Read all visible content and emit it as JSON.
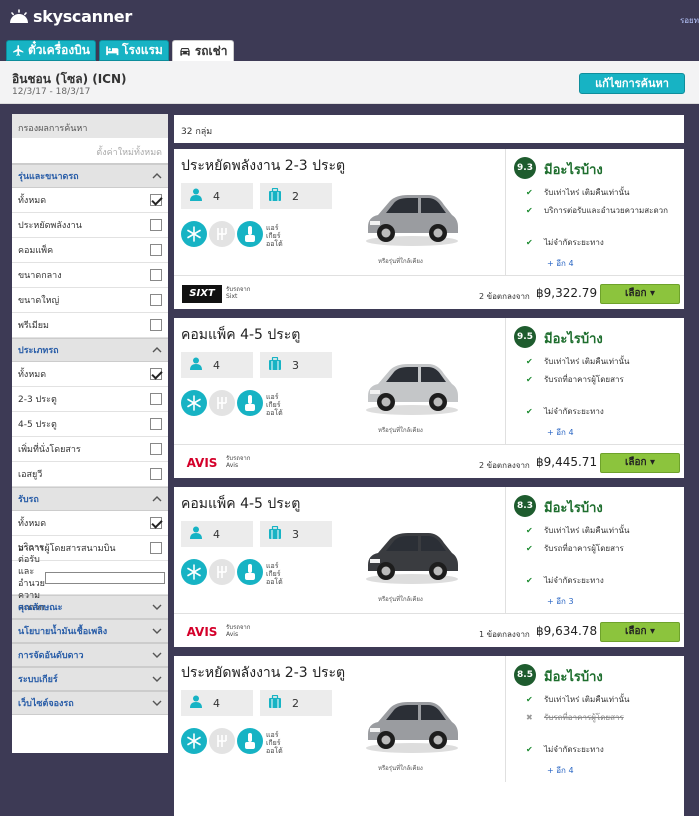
{
  "header": {
    "brand": "skyscanner",
    "top_right": "รอยท"
  },
  "tabs": [
    {
      "label": "ตั๋วเครื่องบิน",
      "icon": "plane-icon",
      "active": false
    },
    {
      "label": "โรงแรม",
      "icon": "bed-icon",
      "active": false
    },
    {
      "label": "รถเช่า",
      "icon": "car-icon",
      "active": true
    }
  ],
  "search": {
    "location": "อินชอน (โซล) (ICN)",
    "dates": "12/3/17 - 18/3/17",
    "edit_label": "แก้ไขการค้นหา"
  },
  "sidebar": {
    "header": "กรองผลการค้นหา",
    "search_placeholder": "ตั้งค่าใหม่ทั้งหมด",
    "sections": [
      {
        "title": "รุ่นและขนาดรถ",
        "expanded": true,
        "options": [
          {
            "label": "ทั้งหมด",
            "checked": true
          },
          {
            "label": "ประหยัดพลังงาน",
            "checked": false
          },
          {
            "label": "คอมแพ็ค",
            "checked": false
          },
          {
            "label": "ขนาดกลาง",
            "checked": false
          },
          {
            "label": "ขนาดใหญ่",
            "checked": false
          },
          {
            "label": "พรีเมียม",
            "checked": false
          }
        ]
      },
      {
        "title": "ประเภทรถ",
        "expanded": true,
        "options": [
          {
            "label": "ทั้งหมด",
            "checked": true
          },
          {
            "label": "2-3 ประตู",
            "checked": false
          },
          {
            "label": "4-5 ประตู",
            "checked": false
          },
          {
            "label": "เพิ่มที่นั่งโดยสาร",
            "checked": false
          },
          {
            "label": "เอสยูวี",
            "checked": false
          }
        ]
      },
      {
        "title": "รับรถ",
        "expanded": true,
        "options": [
          {
            "label": "ทั้งหมด",
            "checked": true
          },
          {
            "label": "อาคารผู้โดยสารสนามบิน",
            "checked": false
          },
          {
            "label": "บริการต่อรับและอำนวยความสะดวก",
            "checked": false
          }
        ]
      },
      {
        "title": "คุณลักษณะ",
        "expanded": false
      },
      {
        "title": "นโยบายน้ำมันเชื้อเพลิง",
        "expanded": false
      },
      {
        "title": "การจัดอันดับดาว",
        "expanded": false
      },
      {
        "title": "ระบบเกียร์",
        "expanded": false
      },
      {
        "title": "เว็บไซต์จองรถ",
        "expanded": false
      }
    ]
  },
  "results": {
    "count_label": "32 กลุ่ม",
    "cards": [
      {
        "title": "ประหยัดพลังงาน 2-3 ประตู",
        "seats": "4",
        "bags": "2",
        "feature_label": [
          "แอร์",
          "เกียร์",
          "ออโต้"
        ],
        "car_color": "#9a9ca0",
        "car_note": "หรือรุ่นที่ใกล้เคียง",
        "score": "9.3",
        "incl_title": "มีอะไรบ้าง",
        "included": [
          {
            "text": "รับเท่าไหร่ เติมคืนเท่านั้น",
            "ok": true
          },
          {
            "text": "บริการต่อรับและอำนวยความสะดวก",
            "ok": true
          },
          {
            "text": "ไม่จำกัดระยะทาง",
            "ok": true
          }
        ],
        "more": "+ อีก 4",
        "supplier": "SIXT",
        "supplier_type": "sixt",
        "supplier_caption": "รับรถจาก",
        "supplier_name": "Sixt",
        "offers": "2 ข้อตกลงจาก",
        "price": "฿9,322.79",
        "select_label": "เลือก ▾"
      },
      {
        "title": "คอมแพ็ค 4-5 ประตู",
        "seats": "4",
        "bags": "3",
        "feature_label": [
          "แอร์",
          "เกียร์",
          "ออโต้"
        ],
        "car_color": "#c4c6c8",
        "car_note": "หรือรุ่นที่ใกล้เคียง",
        "score": "9.5",
        "incl_title": "มีอะไรบ้าง",
        "included": [
          {
            "text": "รับเท่าไหร่ เติมคืนเท่านั้น",
            "ok": true
          },
          {
            "text": "รับรถที่อาคารผู้โดยสาร",
            "ok": true
          },
          {
            "text": "ไม่จำกัดระยะทาง",
            "ok": true
          }
        ],
        "more": "+ อีก 4",
        "supplier": "AVIS",
        "supplier_type": "avis",
        "supplier_caption": "รับรถจาก",
        "supplier_name": "Avis",
        "offers": "2 ข้อตกลงจาก",
        "price": "฿9,445.71",
        "select_label": "เลือก ▾"
      },
      {
        "title": "คอมแพ็ค 4-5 ประตู",
        "seats": "4",
        "bags": "3",
        "feature_label": [
          "แอร์",
          "เกียร์",
          "ออโต้"
        ],
        "car_color": "#3a3c40",
        "car_note": "หรือรุ่นที่ใกล้เคียง",
        "score": "8.3",
        "incl_title": "มีอะไรบ้าง",
        "included": [
          {
            "text": "รับเท่าไหร่ เติมคืนเท่านั้น",
            "ok": true
          },
          {
            "text": "รับรถที่อาคารผู้โดยสาร",
            "ok": true
          },
          {
            "text": "ไม่จำกัดระยะทาง",
            "ok": true
          }
        ],
        "more": "+ อีก 3",
        "supplier": "AVIS",
        "supplier_type": "avis",
        "supplier_caption": "รับรถจาก",
        "supplier_name": "Avis",
        "offers": "1 ข้อตกลงจาก",
        "price": "฿9,634.78",
        "select_label": "เลือก ▾"
      },
      {
        "title": "ประหยัดพลังงาน 2-3 ประตู",
        "seats": "4",
        "bags": "2",
        "feature_label": [
          "แอร์",
          "เกียร์",
          "ออโต้"
        ],
        "car_color": "#9a9ca0",
        "car_note": "หรือรุ่นที่ใกล้เคียง",
        "score": "8.5",
        "incl_title": "มีอะไรบ้าง",
        "included": [
          {
            "text": "รับเท่าไหร่ เติมคืนเท่านั้น",
            "ok": true
          },
          {
            "text": "รับรถที่อาคารผู้โดยสาร",
            "ok": false
          },
          {
            "text": "ไม่จำกัดระยะทาง",
            "ok": true
          }
        ],
        "more": "+ อีก 4",
        "supplier": "",
        "supplier_type": "none",
        "supplier_caption": "",
        "supplier_name": "",
        "offers": "",
        "price": "",
        "select_label": ""
      }
    ]
  }
}
